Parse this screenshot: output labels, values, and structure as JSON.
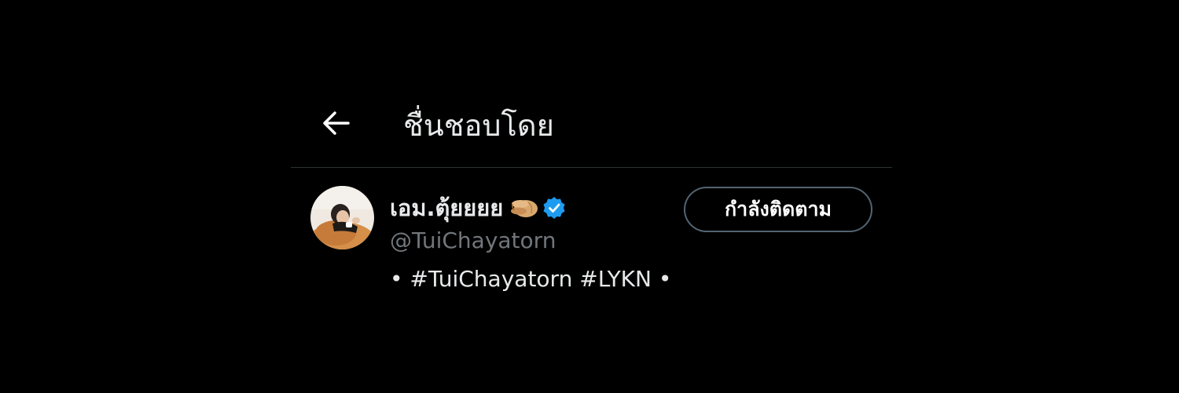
{
  "header": {
    "title": "ชื่นชอบโดย",
    "back_icon": "arrow-left-icon"
  },
  "user": {
    "display_name": "เอม.ตุ้ยยยย",
    "emoji_icon": "pinching-hand-icon",
    "verified_icon": "verified-badge-icon",
    "verified_color": "#1d9bf0",
    "handle": "@TuiChayatorn",
    "bio": {
      "dot_left": "•",
      "tag1": "#TuiChayatorn",
      "tag2": "#LYKN",
      "dot_right": "•"
    },
    "follow_button_label": "กำลังติดตาม"
  },
  "colors": {
    "background": "#000000",
    "text_primary": "#e7e9ea",
    "text_secondary": "#71767b",
    "divider": "#2f3336",
    "button_border": "#536471"
  }
}
